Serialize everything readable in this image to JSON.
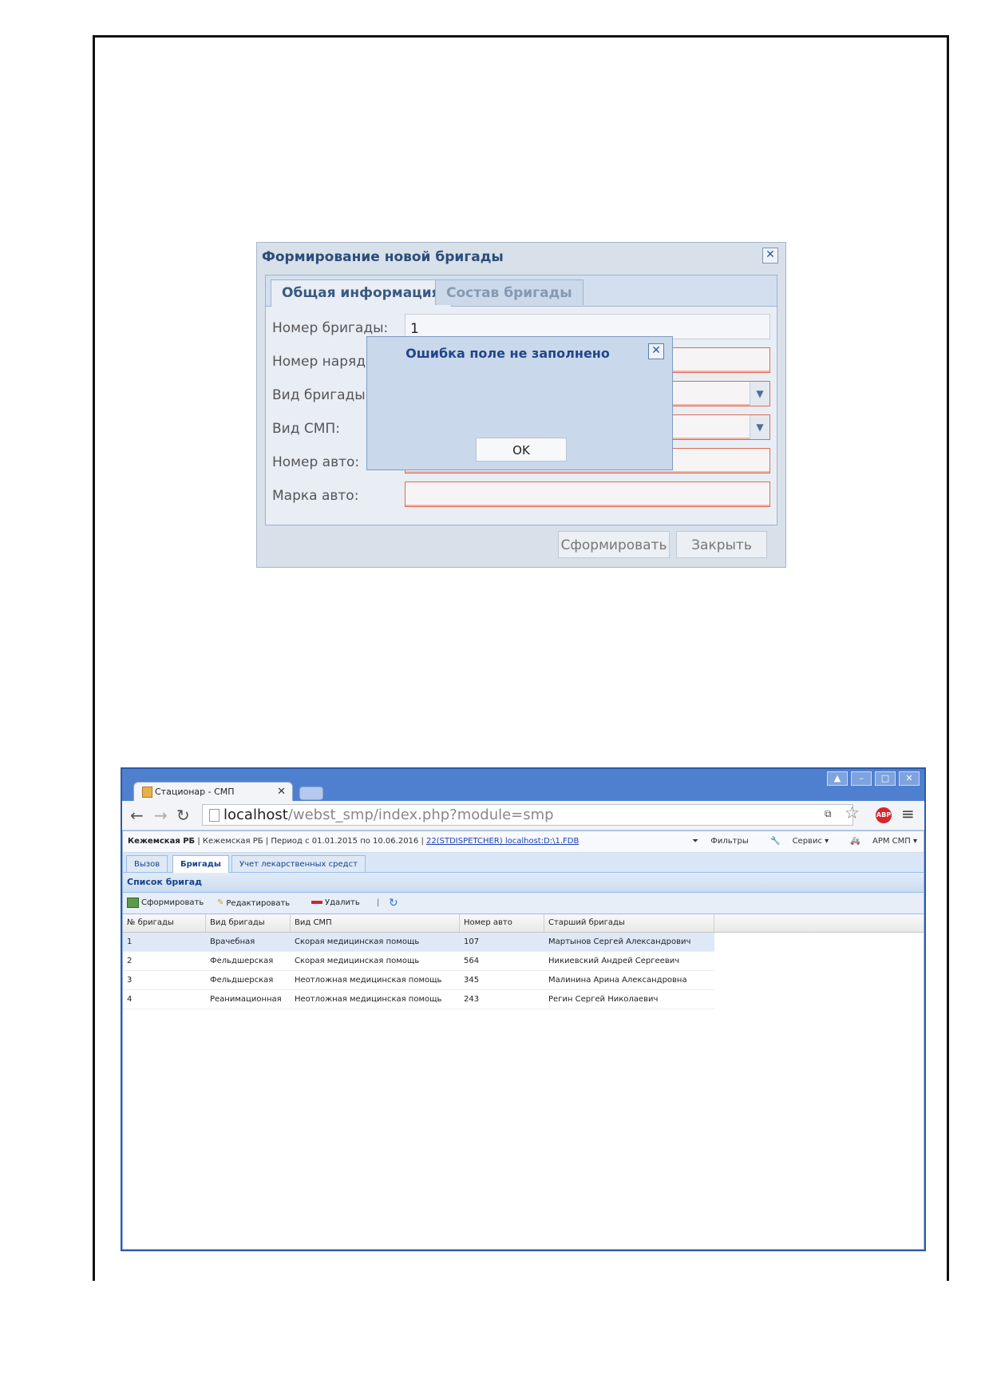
{
  "dialog": {
    "title": "Формирование новой бригады",
    "tabs": [
      "Общая информация",
      "Состав бригады"
    ],
    "fields": [
      {
        "label": "Номер бригады:",
        "value": "1"
      },
      {
        "label": "Номер наряд",
        "value": ""
      },
      {
        "label": "Вид бригады:",
        "value": ""
      },
      {
        "label": "Вид СМП:",
        "value": ""
      },
      {
        "label": "Номер авто:",
        "value": ""
      },
      {
        "label": "Марка авто:",
        "value": ""
      }
    ],
    "buttons": {
      "create": "Сформировать",
      "close": "Закрыть"
    }
  },
  "error": {
    "title": "Ошибка поле не заполнено",
    "ok": "OK"
  },
  "browser": {
    "tab_title": "Стационар - СМП",
    "url_host": "localhost",
    "url_path": "/webst_smp/index.php?module=smp",
    "window_buttons": [
      "▲",
      "–",
      "□",
      "✕"
    ]
  },
  "app": {
    "info": {
      "org_bold": "Кежемская РБ",
      "org": " | Кежемская РБ | Период с 01.01.2015 по 10.06.2016 | ",
      "link": "22(STDISPETCHER) localhost:D:\\1.FDB",
      "filters": "Фильтры",
      "service": "Сервис ▾",
      "arm": "АРМ СМП ▾"
    },
    "tabs": [
      "Вызов",
      "Бригады",
      "Учет лекарственных средст"
    ],
    "panel_title": "Список бригад",
    "toolbar": {
      "create": "Сформировать",
      "edit": "Редактировать",
      "delete": "Удалить"
    },
    "grid": {
      "columns": [
        "№ бригады",
        "Вид бригады",
        "Вид СМП",
        "Номер авто",
        "Старший бригады"
      ],
      "rows": [
        [
          "1",
          "Врачебная",
          "Скорая медицинская помощь",
          "107",
          "Мартынов Сергей Александрович"
        ],
        [
          "2",
          "Фельдшерская",
          "Скорая медицинская помощь",
          "564",
          "Никиевский Андрей Сергеевич"
        ],
        [
          "3",
          "Фельдшерская",
          "Неотложная медицинская помощь",
          "345",
          "Малинина Арина Александровна"
        ],
        [
          "4",
          "Реанимационная",
          "Неотложная медицинская помощь",
          "243",
          "Регин Сергей Николаевич"
        ]
      ]
    }
  }
}
